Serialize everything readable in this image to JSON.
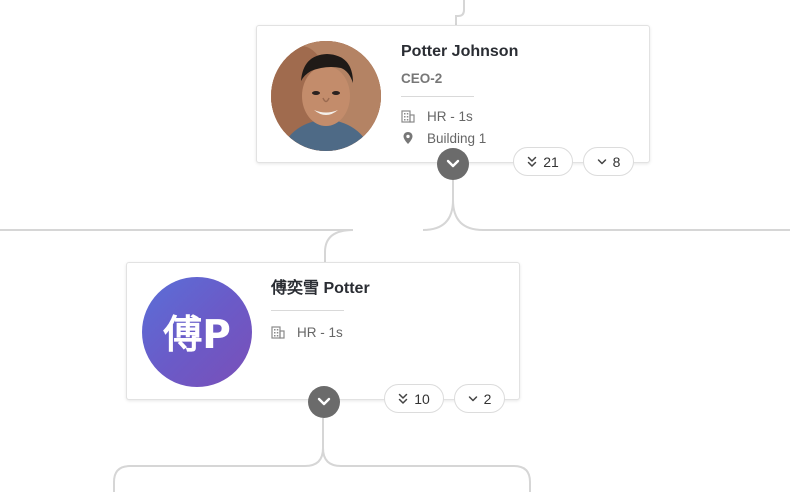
{
  "nodes": {
    "potter": {
      "name": "Potter Johnson",
      "title": "CEO-2",
      "department": "HR - 1s",
      "location": "Building 1",
      "total_reports": "21",
      "direct_reports": "8"
    },
    "fu": {
      "name": "傅奕雪 Potter",
      "initials": "傅P",
      "department": "HR - 1s",
      "total_reports": "10",
      "direct_reports": "2"
    }
  },
  "colors": {
    "connector": "#d6d6d6",
    "toggle": "#6b6b6b",
    "avatar_gradient_start": "#5a6fd8",
    "avatar_gradient_end": "#7a4fb8"
  },
  "icons": {
    "department": "building-icon",
    "location": "map-pin-icon",
    "total_reports": "double-chevron-down-icon",
    "direct_reports": "chevron-down-icon",
    "toggle": "chevron-down-icon"
  }
}
